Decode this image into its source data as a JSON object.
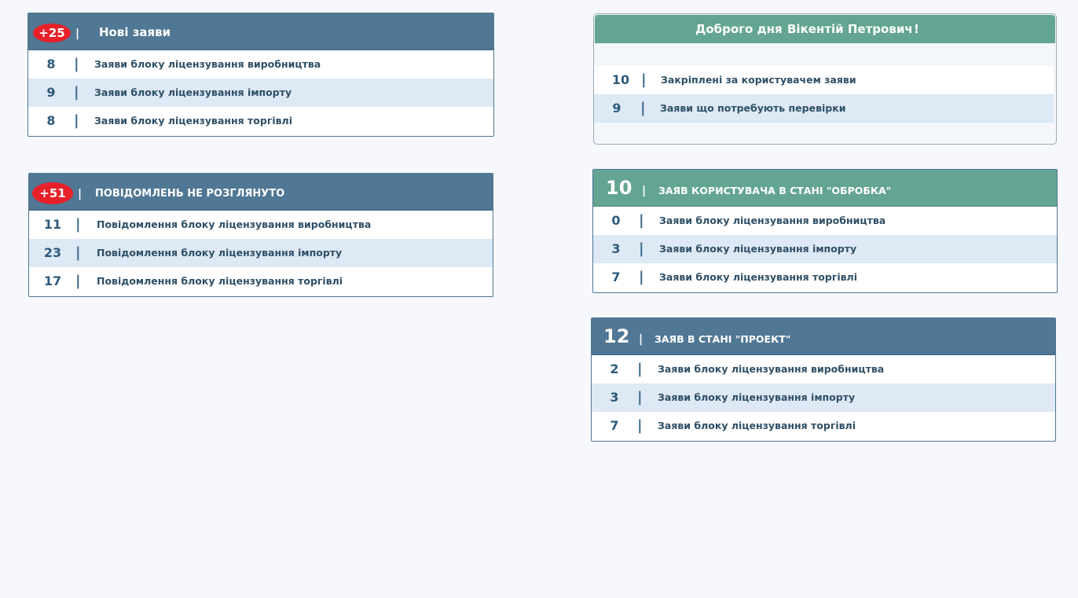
{
  "new_applications": {
    "badge": "+25",
    "title": "Нові заяви",
    "rows": [
      {
        "count": "8",
        "label": "Заяви блоку ліцензування виробництва"
      },
      {
        "count": "9",
        "label": "Заяви блоку ліцензування імпорту"
      },
      {
        "count": "8",
        "label": "Заяви блоку ліцензування торгівлі"
      }
    ]
  },
  "messages": {
    "badge": "+51",
    "title": "ПОВІДОМЛЕНЬ НЕ РОЗГЛЯНУТО",
    "rows": [
      {
        "count": "11",
        "label": "Повідомлення блоку ліцензування виробництва"
      },
      {
        "count": "23",
        "label": "Повідомлення блоку ліцензування імпорту"
      },
      {
        "count": "17",
        "label": "Повідомлення блоку ліцензування торгівлі"
      }
    ]
  },
  "greeting": {
    "text": "Доброго дня",
    "user_name": "Вікентій Петрович",
    "exclamation": "!",
    "rows": [
      {
        "count": "10",
        "label": "Закріплені за користувачем заяви"
      },
      {
        "count": "9",
        "label": "Заяви що потребують перевірки"
      }
    ]
  },
  "processing": {
    "count": "10",
    "title": "ЗАЯВ КОРИСТУВАЧА  В СТАНІ \"ОБРОБКА\"",
    "rows": [
      {
        "count": "0",
        "label": "Заяви блоку ліцензування виробництва"
      },
      {
        "count": "3",
        "label": "Заяви блоку ліцензування імпорту"
      },
      {
        "count": "7",
        "label": "Заяви блоку ліцензування торгівлі"
      }
    ]
  },
  "project": {
    "count": "12",
    "title": "ЗАЯВ  В СТАНІ \"ПРОЕКТ\"",
    "rows": [
      {
        "count": "2",
        "label": "Заяви блоку ліцензування виробництва"
      },
      {
        "count": "3",
        "label": "Заяви блоку ліцензування імпорту"
      },
      {
        "count": "7",
        "label": "Заяви блоку ліцензування торгівлі"
      }
    ]
  },
  "separator": "|",
  "colors": {
    "header_blue": "#507794",
    "header_green": "#63a592",
    "badge_red": "#e8202a",
    "row_alt": "#dde9f4",
    "background": "#f6f8fd"
  }
}
